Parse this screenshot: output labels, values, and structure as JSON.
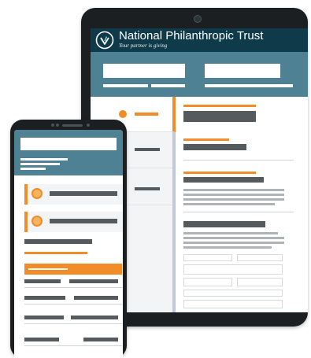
{
  "header": {
    "brand_name": "National Philanthropic Trust",
    "tagline": "Your partner is giving",
    "logo_icon": "leaf-check-icon"
  },
  "colors": {
    "header_dark": "#0f3a4a",
    "header_band": "#4f8194",
    "accent": "#f28c28",
    "placeholder_gray": "#555a5f",
    "light_gray": "#aeb3b8",
    "sidebar_bg": "#f2f4f6"
  },
  "devices": {
    "tablet": "tablet-device",
    "phone": "phone-device"
  }
}
